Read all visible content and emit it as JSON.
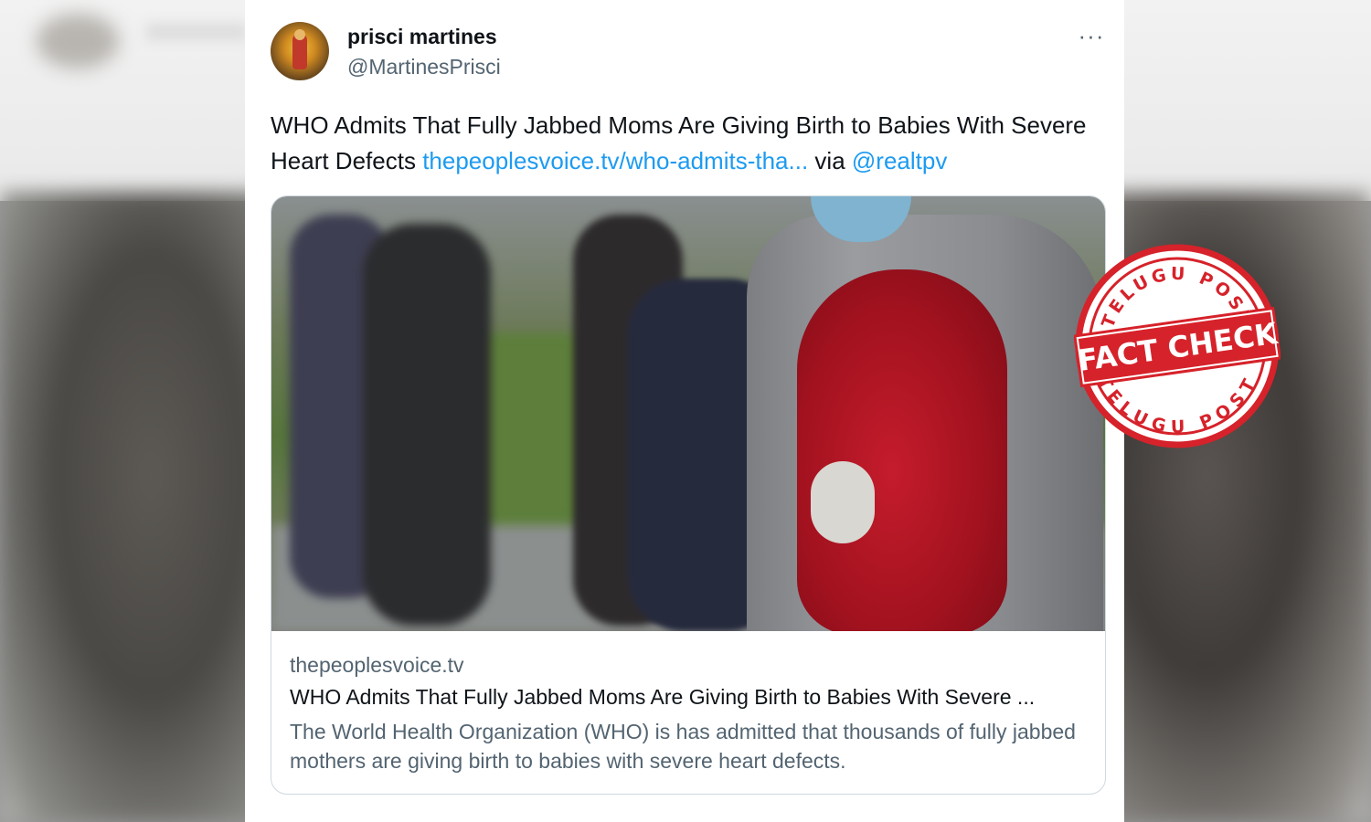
{
  "tweet": {
    "display_name": "prisci martines",
    "handle": "@MartinesPrisci",
    "more_label": "···",
    "text": {
      "body": "WHO Admits That Fully Jabbed Moms Are Giving Birth to Babies With Severe Heart Defects",
      "link": "thepeoplesvoice.tv/who-admits-tha...",
      "via": "via",
      "mention": "@realtpv"
    }
  },
  "link_card": {
    "domain": "thepeoplesvoice.tv",
    "title": "WHO Admits That Fully Jabbed Moms Are Giving Birth to Babies With Severe ...",
    "description": "The World Health Organization (WHO) is has admitted that thousands of fully jabbed mothers are giving birth to babies with severe heart defects.",
    "image_alt": "pregnant-woman-in-mask-photo"
  },
  "stamp": {
    "top_text": "TELUGU POST",
    "bottom_text": "TELUGU POST",
    "center_text": "FACT CHECK",
    "color": "#d6222a"
  },
  "colors": {
    "link": "#1d9bf0",
    "text": "#0f1419",
    "secondary": "#536471",
    "border": "#cfd9de"
  }
}
